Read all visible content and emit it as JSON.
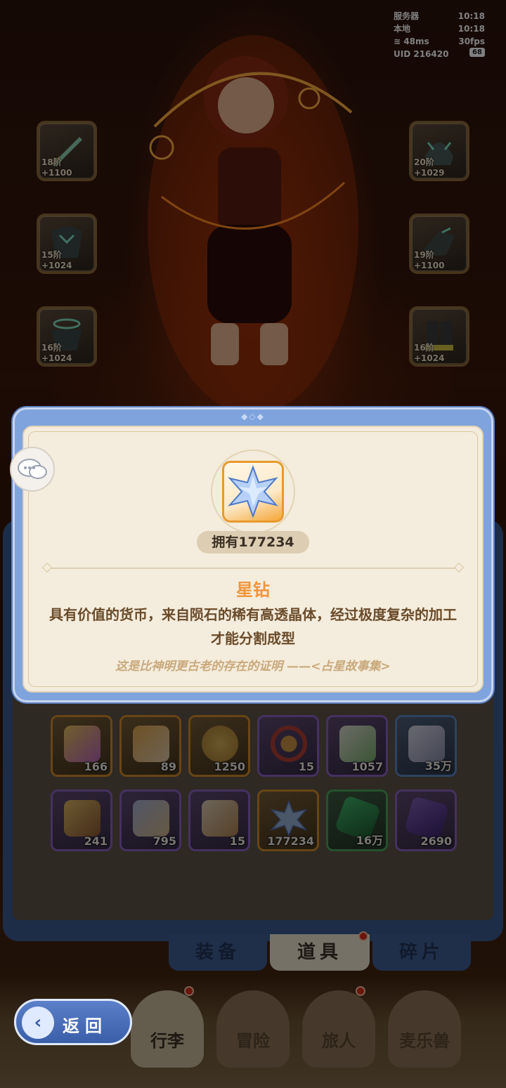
{
  "status": {
    "server_label": "服务器",
    "server_time": "10:18",
    "local_label": "本地",
    "local_time": "10:18",
    "ping": "48ms",
    "fps": "30fps",
    "uid": "UID 216420",
    "battery": "68"
  },
  "equipment": [
    {
      "level": "18阶 +1100",
      "icon": "sword-icon"
    },
    {
      "level": "20阶 +1029",
      "icon": "helmet-icon"
    },
    {
      "level": "15阶 +1024",
      "icon": "armor-icon"
    },
    {
      "level": "19阶 +1100",
      "icon": "gauntlet-icon"
    },
    {
      "level": "16阶 +1024",
      "icon": "pauldron-icon"
    },
    {
      "level": "16阶 +1024",
      "icon": "boots-icon"
    }
  ],
  "inventory": {
    "items": [
      {
        "count": "166",
        "icon": "bottle-icon",
        "rarity": "orange"
      },
      {
        "count": "89",
        "icon": "card-icon",
        "rarity": "orange"
      },
      {
        "count": "1250",
        "icon": "bell-icon",
        "rarity": "orange"
      },
      {
        "count": "15",
        "icon": "horseshoe-icon",
        "rarity": "purple"
      },
      {
        "count": "1057",
        "icon": "potion-icon",
        "rarity": "purple"
      },
      {
        "count": "35万",
        "icon": "rice-ball-icon",
        "rarity": "blue"
      },
      {
        "count": "241",
        "icon": "pudding-icon",
        "rarity": "purple"
      },
      {
        "count": "795",
        "icon": "spoon-icon",
        "rarity": "purple"
      },
      {
        "count": "15",
        "icon": "pouch-icon",
        "rarity": "purple"
      },
      {
        "count": "177234",
        "icon": "star-diamond-icon",
        "rarity": "orange"
      },
      {
        "count": "16万",
        "icon": "green-gem-icon",
        "rarity": "green"
      },
      {
        "count": "2690",
        "icon": "purple-crystal-icon",
        "rarity": "purple"
      }
    ]
  },
  "tabs": {
    "equipment": "装备",
    "items": "道具",
    "fragments": "碎片"
  },
  "nav": {
    "back": "返回",
    "luggage": "行李",
    "adventure": "冒险",
    "traveler": "旅人",
    "pet": "麦乐兽"
  },
  "modal": {
    "owned": "拥有177234",
    "name": "星钻",
    "description": "具有价值的货币，来自陨石的稀有高透晶体，经过极度复杂的加工才能分割成型",
    "quote": "这是比神明更古老的存在的证明 ——<占星故事集>",
    "icon": "star-diamond-icon"
  },
  "colors": {
    "accent_orange": "#f0953a",
    "frame_blue": "#7fa3dd",
    "parchment": "#f4ecdc"
  }
}
